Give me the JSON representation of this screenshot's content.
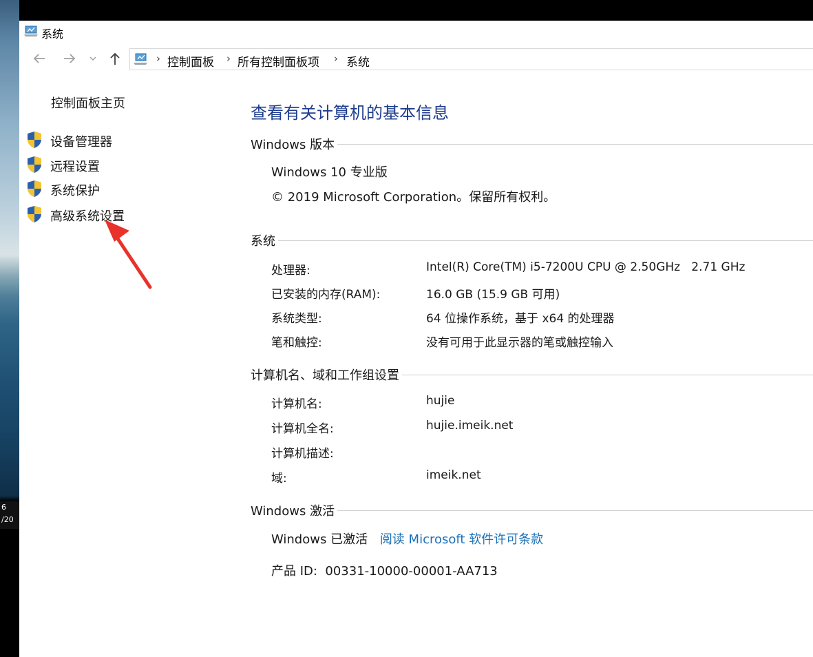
{
  "window": {
    "title": "系统"
  },
  "taskbar": {
    "clock_line1": "6",
    "clock_line2": "/20"
  },
  "nav": {
    "back_icon": "arrow-left-icon",
    "forward_icon": "arrow-right-icon",
    "dropdown_icon": "chevron-down-icon",
    "up_icon": "arrow-up-icon"
  },
  "breadcrumb": [
    "控制面板",
    "所有控制面板项",
    "系统"
  ],
  "sidebar": {
    "home": "控制面板主页",
    "items": [
      {
        "label": "设备管理器",
        "icon": "uac-shield-icon"
      },
      {
        "label": "远程设置",
        "icon": "uac-shield-icon"
      },
      {
        "label": "系统保护",
        "icon": "uac-shield-icon"
      },
      {
        "label": "高级系统设置",
        "icon": "uac-shield-icon"
      }
    ]
  },
  "main": {
    "heading": "查看有关计算机的基本信息",
    "edition": {
      "title": "Windows 版本",
      "name": "Windows 10 专业版",
      "copyright": "© 2019 Microsoft Corporation。保留所有权利。"
    },
    "system": {
      "title": "系统",
      "rows": [
        {
          "label": "处理器:",
          "value": "Intel(R) Core(TM) i5-7200U CPU @ 2.50GHz   2.71 GHz"
        },
        {
          "label": "已安装的内存(RAM):",
          "value": "16.0 GB (15.9 GB 可用)"
        },
        {
          "label": "系统类型:",
          "value": "64 位操作系统，基于 x64 的处理器"
        },
        {
          "label": "笔和触控:",
          "value": "没有可用于此显示器的笔或触控输入"
        }
      ]
    },
    "computer": {
      "title": "计算机名、域和工作组设置",
      "rows": [
        {
          "label": "计算机名:",
          "value": "hujie"
        },
        {
          "label": "计算机全名:",
          "value": "hujie.imeik.net"
        },
        {
          "label": "计算机描述:",
          "value": ""
        },
        {
          "label": "域:",
          "value": "imeik.net"
        }
      ]
    },
    "activation": {
      "title": "Windows 激活",
      "status": "Windows 已激活",
      "license_link": "阅读 Microsoft 软件许可条款",
      "product_id": "产品 ID:  00331-10000-00001-AA713"
    }
  },
  "colors": {
    "heading": "#1e3d8f",
    "link": "#1a70b8",
    "annotation_arrow": "#e8322a"
  }
}
